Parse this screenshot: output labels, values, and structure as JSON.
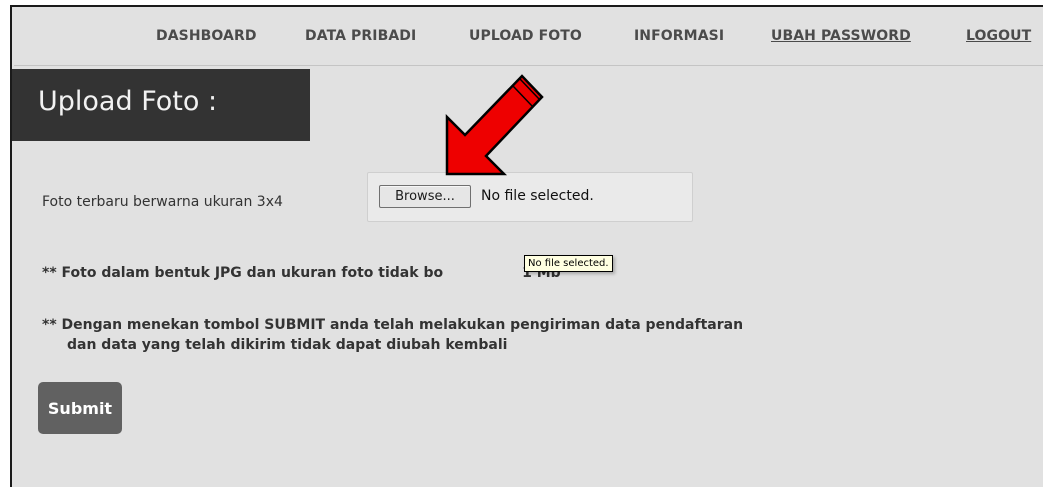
{
  "nav": {
    "items": [
      {
        "label": "DASHBOARD",
        "underlined": false
      },
      {
        "label": "DATA PRIBADI",
        "underlined": false
      },
      {
        "label": "UPLOAD FOTO",
        "underlined": false
      },
      {
        "label": "INFORMASI",
        "underlined": false
      },
      {
        "label": "UBAH PASSWORD",
        "underlined": true
      },
      {
        "label": "LOGOUT",
        "underlined": true
      }
    ]
  },
  "page": {
    "title": "Upload Foto :"
  },
  "upload": {
    "label": "Foto terbaru berwarna ukuran 3x4",
    "browse_label": "Browse...",
    "status": "No file selected."
  },
  "tooltip": {
    "text": "No file selected."
  },
  "notes": {
    "note1_before": "** Foto dalam bentuk JPG dan ukuran foto tidak bo",
    "note1_after": "1 Mb",
    "note2_line1": "** Dengan menekan tombol SUBMIT anda telah melakukan pengiriman data pendaftaran",
    "note2_line2": "dan data yang telah dikirim tidak dapat diubah kembali"
  },
  "submit": {
    "label": "Submit"
  },
  "annotation": {
    "arrow_color": "#ee0000",
    "arrow_icon": "red-pointer-arrow"
  }
}
